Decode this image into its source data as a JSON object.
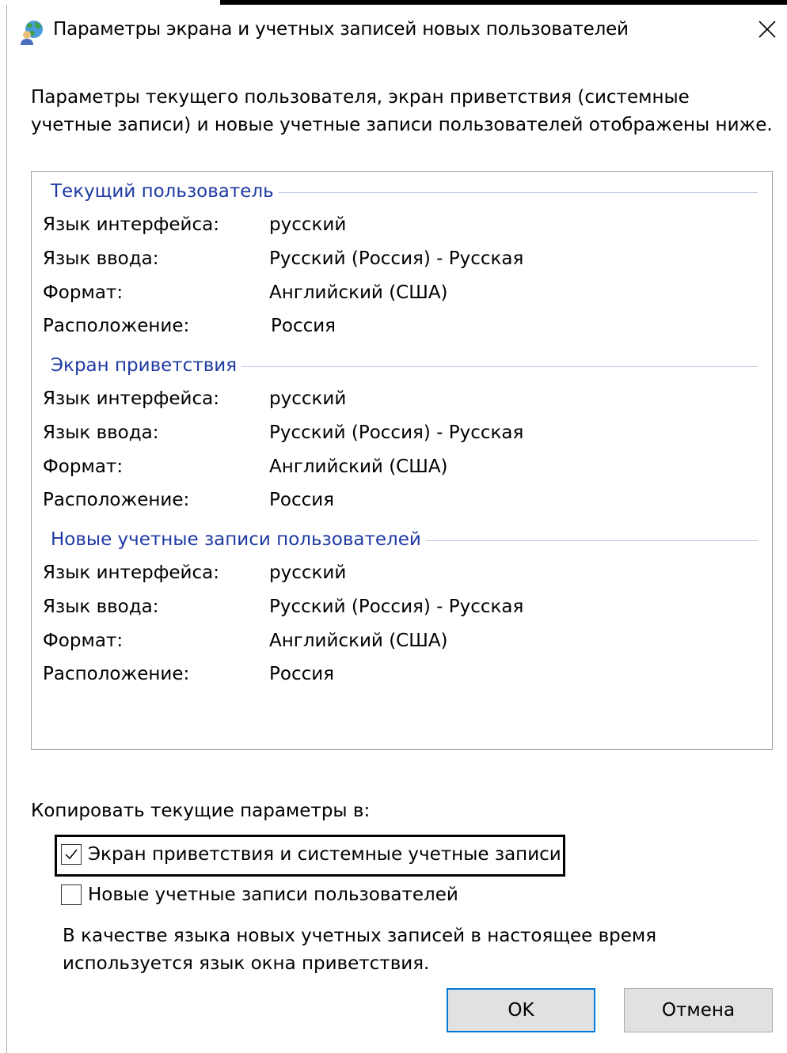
{
  "window": {
    "title": "Параметры экрана и учетных записей новых пользователей"
  },
  "description": "Параметры текущего пользователя, экран приветствия (системные учетные записи) и новые учетные записи пользователей отображены ниже.",
  "sections": [
    {
      "title": "Текущий пользователь",
      "rows": [
        {
          "label": "Язык интерфейса:",
          "value": "русский"
        },
        {
          "label": "Язык ввода:",
          "value": "Русский (Россия) - Русская"
        },
        {
          "label": "Формат:",
          "value": "Английский (США)"
        },
        {
          "label": "Расположение:",
          "value": "Россия"
        }
      ]
    },
    {
      "title": "Экран приветствия",
      "rows": [
        {
          "label": "Язык интерфейса:",
          "value": "русский"
        },
        {
          "label": "Язык ввода:",
          "value": "Русский (Россия) - Русская"
        },
        {
          "label": "Формат:",
          "value": "Английский (США)"
        },
        {
          "label": "Расположение:",
          "value": "Россия"
        }
      ]
    },
    {
      "title": "Новые учетные записи пользователей",
      "rows": [
        {
          "label": "Язык интерфейса:",
          "value": "русский"
        },
        {
          "label": "Язык ввода:",
          "value": "Русский (Россия) - Русская"
        },
        {
          "label": "Формат:",
          "value": "Английский (США)"
        },
        {
          "label": "Расположение:",
          "value": "Россия"
        }
      ]
    }
  ],
  "copy": {
    "label": "Копировать текущие параметры в:",
    "options": [
      {
        "label": "Экран приветствия и системные учетные записи",
        "checked": true
      },
      {
        "label": "Новые учетные записи пользователей",
        "checked": false
      }
    ]
  },
  "note": "В качестве языка новых учетных записей в настоящее время используется язык окна приветствия.",
  "buttons": {
    "ok": "OK",
    "cancel": "Отмена"
  },
  "colors": {
    "section_title": "#1f3aa3",
    "default_button_border": "#0078d7"
  },
  "icons": {
    "title": "globe-user-icon",
    "close": "close-icon",
    "check": "checkmark-icon"
  }
}
